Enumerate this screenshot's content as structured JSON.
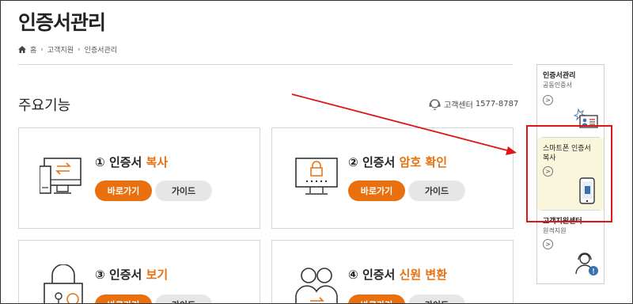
{
  "page": {
    "title": "인증서관리"
  },
  "breadcrumb": {
    "home": "홈",
    "level1": "고객지원",
    "level2": "인증서관리"
  },
  "section": {
    "title": "주요기능",
    "cs_label": "고객센터",
    "cs_number": "1577-8787"
  },
  "cards": [
    {
      "num": "①",
      "prefix": "인증서",
      "highlight": "복사",
      "go_label": "바로가기",
      "guide_label": "가이드"
    },
    {
      "num": "②",
      "prefix": "인증서",
      "highlight": "암호 확인",
      "go_label": "바로가기",
      "guide_label": "가이드"
    },
    {
      "num": "③",
      "prefix": "인증서",
      "highlight": "보기",
      "go_label": "바로가기",
      "guide_label": "가이드"
    },
    {
      "num": "④",
      "prefix": "인증서",
      "highlight": "신원 변환",
      "go_label": "바로가기",
      "guide_label": "가이드"
    }
  ],
  "sidebar": {
    "items": [
      {
        "title": "인증서관리",
        "sub": "공동인증서",
        "icon": "id-card-icon"
      },
      {
        "title": "스마트폰 인증서 복사",
        "sub": "",
        "icon": "smartphone-icon"
      },
      {
        "title": "고객지원센터",
        "sub": "원격지원",
        "icon": "support-agent-icon"
      }
    ]
  },
  "colors": {
    "accent": "#e8700f",
    "annotation": "#e01515",
    "sidebar_highlight_bg": "#faf6dc"
  }
}
